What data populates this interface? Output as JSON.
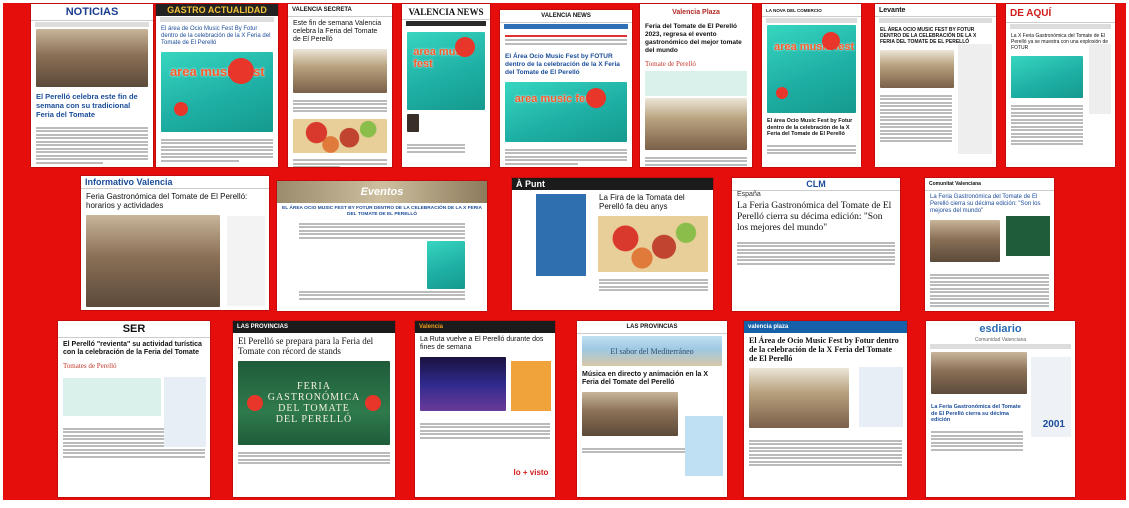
{
  "background_color": "#e60d0d",
  "row1": {
    "c1": {
      "logo": "NOTICIAS",
      "headline": "El Perelló celebra este fin de semana con su tradicional Feria del Tomate"
    },
    "c2": {
      "logo": "GASTRO ACTUALIDAD",
      "headline": "El área de Ocio Music Fest By Fotur dentro de la celebración de la X Feria del Tomate de El Perelló",
      "poster": "area music fest"
    },
    "c3": {
      "logo": "VALENCIA SECRETA",
      "headline": "Este fin de semana Valencia celebra la Feria del Tomate de El Perelló"
    },
    "c4": {
      "logo": "VALENCIA NEWS",
      "poster": "area music fest"
    },
    "c5": {
      "logo": "VALENCIA NEWS",
      "headline": "El Área Ocio Music Fest by FOTUR dentro de la celebración de la X Feria del Tomate de El Perelló",
      "poster": "area music fest"
    },
    "c6": {
      "logo": "Valencia Plaza",
      "headline": "Feria del Tomate de El Perelló 2023, regresa el evento gastronómico del mejor tomate del mundo",
      "poster": "Tomate de Perelló"
    },
    "c7": {
      "logo": "LA NOVA DEL COMERCIO",
      "headline": "El área Ocio Music Fest by Fotur dentro de la celebración de la X Feria del Tomate de El Perelló",
      "poster": "area music fest"
    },
    "c8": {
      "logo": "Levante",
      "headline": "EL ÁREA OCIO MUSIC FEST BY FOTUR DENTRO DE LA CELEBRACIÓN DE LA X FERIA DEL TOMATE DE EL PERELLÓ"
    },
    "c9": {
      "logo": "DE AQUÍ",
      "headline": "La X Feria Gastronómica del Tomate de El Perelló ya se muestra con una explosión de FOTUR"
    }
  },
  "row2": {
    "c1": {
      "logo": "Informativo Valencia",
      "headline": "Feria Gastronómica del Tomate de El Perelló: horarios y actividades"
    },
    "c2": {
      "logo": "Eventos",
      "headline": "EL ÁREA OCIO MUSIC FEST BY FOTUR DENTRO DE LA CELEBRACIÓN DE LA X FERIA DEL TOMATE DE EL PERELLÓ"
    },
    "c3": {
      "logo": "À Punt",
      "headline": "La Fira de la Tomata del Perelló fa deu anys"
    },
    "c4": {
      "logo": "CLM",
      "section": "España",
      "headline": "La Feria Gastronómica del Tomate de El Perelló cierra su décima edición: \"Son los mejores del mundo\""
    },
    "c5": {
      "logo": "Comunitat Valenciana",
      "headline": "La Feria Gastronómica del Tomate de El Perelló cierra su décima edición: \"Son los mejores del mundo\""
    }
  },
  "row3": {
    "c1": {
      "logo": "SER",
      "headline": "El Perelló \"revienta\" su actividad turística con la celebración de la Feria del Tomate",
      "poster": "Tomates de Perelló"
    },
    "c2": {
      "logo": "LAS PROVINCIAS",
      "headline": "El Perelló se prepara para la Feria del Tomate con récord de stands",
      "poster_line1": "FERIA",
      "poster_line2": "GASTRONÓMICA",
      "poster_line3": "DEL TOMATE",
      "poster_line4": "DEL PERELLÓ"
    },
    "c3": {
      "logo": "Valencia",
      "headline": "La Ruta vuelve a El Perelló durante dos fines de semana",
      "ad_text": "lo + visto"
    },
    "c4": {
      "logo": "LAS PROVINCIAS",
      "banner": "El sabor del Mediterráneo",
      "headline": "Música en directo y animación en la X Feria del Tomate del Perelló"
    },
    "c5": {
      "logo": "valencia plaza",
      "headline": "El Área de Ocio Music Fest by Fotur dentro de la celebración de la X Feria del Tomate de El Perelló"
    },
    "c6": {
      "logo": "esdiario",
      "subtitle": "Comunidad Valenciana",
      "headline": "La Feria Gastronómica del Tomate de El Perelló cierra su décima edición",
      "ad_number": "2001"
    }
  }
}
